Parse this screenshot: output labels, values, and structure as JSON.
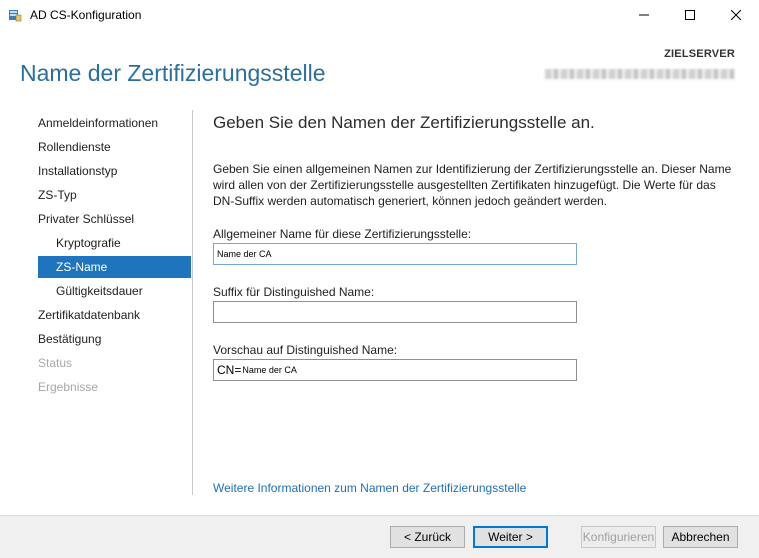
{
  "window": {
    "title": "AD CS-Konfiguration"
  },
  "header": {
    "page_title": "Name der Zertifizierungsstelle",
    "server_label": "ZIELSERVER"
  },
  "nav": {
    "items": [
      {
        "label": "Anmeldeinformationen",
        "state": "normal"
      },
      {
        "label": "Rollendienste",
        "state": "normal"
      },
      {
        "label": "Installationstyp",
        "state": "normal"
      },
      {
        "label": "ZS-Typ",
        "state": "normal"
      },
      {
        "label": "Privater Schlüssel",
        "state": "normal"
      },
      {
        "label": "Kryptografie",
        "state": "sub"
      },
      {
        "label": "ZS-Name",
        "state": "active"
      },
      {
        "label": "Gültigkeitsdauer",
        "state": "sub"
      },
      {
        "label": "Zertifikatdatenbank",
        "state": "normal"
      },
      {
        "label": "Bestätigung",
        "state": "normal"
      },
      {
        "label": "Status",
        "state": "disabled"
      },
      {
        "label": "Ergebnisse",
        "state": "disabled"
      }
    ]
  },
  "main": {
    "section_title": "Geben Sie den Namen der Zertifizierungsstelle an.",
    "description": "Geben Sie einen allgemeinen Namen zur Identifizierung der Zertifizierungsstelle an. Dieser Name wird allen von der Zertifizierungsstelle ausgestellten Zertifikaten hinzugefügt. Die Werte für das DN-Suffix werden automatisch generiert, können jedoch geändert werden.",
    "common_name_label": "Allgemeiner Name für diese Zertifizierungsstelle:",
    "common_name_value": "Name der CA",
    "dn_suffix_label": "Suffix für Distinguished Name:",
    "dn_suffix_value": "",
    "preview_label": "Vorschau auf Distinguished Name:",
    "preview_prefix": "CN=",
    "preview_value": "Name der CA",
    "more_info_link": "Weitere Informationen zum Namen der Zertifizierungsstelle"
  },
  "footer": {
    "back_label": "< Zurück",
    "next_label": "Weiter >",
    "configure_label": "Konfigurieren",
    "cancel_label": "Abbrechen"
  },
  "colors": {
    "accent": "#1e75bd",
    "title_blue": "#2b6f9e",
    "link": "#1e6fc0"
  },
  "icons": {
    "app": "server-manager-icon",
    "minimize": "minimize-icon",
    "maximize": "maximize-icon",
    "close": "close-icon"
  }
}
